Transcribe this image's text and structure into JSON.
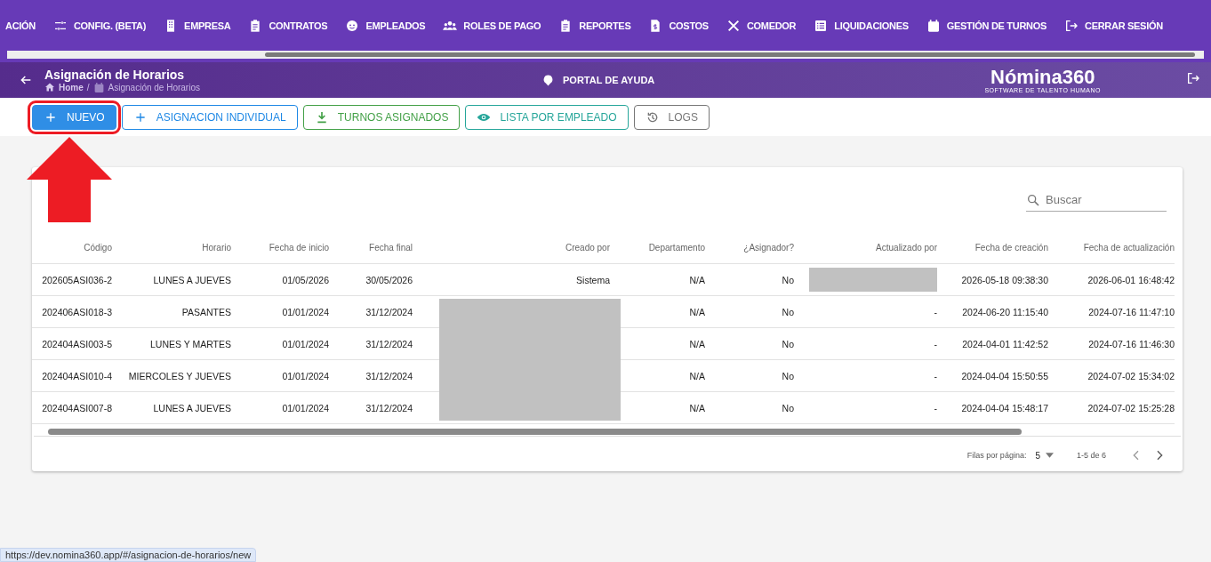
{
  "top_nav": [
    {
      "label": "ACIÓN"
    },
    {
      "label": "CONFIG. (BETA)"
    },
    {
      "label": "EMPRESA"
    },
    {
      "label": "CONTRATOS"
    },
    {
      "label": "EMPLEADOS"
    },
    {
      "label": "ROLES DE PAGO"
    },
    {
      "label": "REPORTES"
    },
    {
      "label": "COSTOS"
    },
    {
      "label": "COMEDOR"
    },
    {
      "label": "LIQUIDACIONES"
    },
    {
      "label": "GESTIÓN DE TURNOS"
    },
    {
      "label": "CERRAR SESIÓN"
    }
  ],
  "header": {
    "title": "Asignación de Horarios",
    "breadcrumb": [
      "Home",
      "Asignación de Horarios"
    ],
    "breadcrumb_separator": "/",
    "help": "PORTAL DE AYUDA",
    "logo": "Nómina360",
    "logo_tagline": "SOFTWARE DE TALENTO HUMANO"
  },
  "toolbar": [
    {
      "label": "NUEVO",
      "kind": "primary",
      "highlighted": true
    },
    {
      "label": "ASIGNACION INDIVIDUAL",
      "kind": "blue",
      "highlighted": false
    },
    {
      "label": "TURNOS ASIGNADOS",
      "kind": "green",
      "highlighted": false
    },
    {
      "label": "LISTA POR EMPLEADO",
      "kind": "teal",
      "highlighted": false
    },
    {
      "label": "LOGS",
      "kind": "grey",
      "highlighted": false
    }
  ],
  "search": {
    "placeholder": "Buscar"
  },
  "table": {
    "columns": [
      "Código",
      "Horario",
      "Fecha de inicio",
      "Fecha final",
      "Creado por",
      "Departamento",
      "¿Asignador?",
      "Actualizado por",
      "Fecha de creación",
      "Fecha de actualización"
    ],
    "rows": [
      {
        "codigo": "202605ASI036-2",
        "horario": "LUNES A JUEVES",
        "inicio": "01/05/2026",
        "final": "30/05/2026",
        "creado_por": "Sistema",
        "creado_por_redacted": false,
        "departamento": "N/A",
        "asignador": "No",
        "actualizado_por_redacted": true,
        "creacion": "2026-05-18 09:38:30",
        "actualizacion": "2026-06-01 16:48:42"
      },
      {
        "codigo": "202406ASI018-3",
        "horario": "PASANTES",
        "inicio": "01/01/2024",
        "final": "31/12/2024",
        "creado_por_redacted": true,
        "departamento": "N/A",
        "asignador": "No",
        "actualizado_por": "-",
        "actualizado_por_redacted": false,
        "creacion": "2024-06-20 11:15:40",
        "actualizacion": "2024-07-16 11:47:10"
      },
      {
        "codigo": "202404ASI003-5",
        "horario": "LUNES Y MARTES",
        "inicio": "01/01/2024",
        "final": "31/12/2024",
        "creado_por_redacted": true,
        "departamento": "N/A",
        "asignador": "No",
        "actualizado_por": "-",
        "actualizado_por_redacted": false,
        "creacion": "2024-04-01 11:42:52",
        "actualizacion": "2024-07-16 11:46:30"
      },
      {
        "codigo": "202404ASI010-4",
        "horario": "MIERCOLES Y JUEVES",
        "inicio": "01/01/2024",
        "final": "31/12/2024",
        "creado_por_redacted": true,
        "departamento": "N/A",
        "asignador": "No",
        "actualizado_por": "-",
        "actualizado_por_redacted": false,
        "creacion": "2024-04-04 15:50:55",
        "actualizacion": "2024-07-02 15:34:02"
      },
      {
        "codigo": "202404ASI007-8",
        "horario": "LUNES A JUEVES",
        "inicio": "01/01/2024",
        "final": "31/12/2024",
        "creado_por_redacted": true,
        "departamento": "N/A",
        "asignador": "No",
        "actualizado_por": "-",
        "actualizado_por_redacted": false,
        "creacion": "2024-04-04 15:48:17",
        "actualizacion": "2024-07-02 15:25:28"
      }
    ]
  },
  "pagination": {
    "rows_label": "Filas por página:",
    "rows_value": "5",
    "range": "1-5 de 6"
  },
  "status_bar": {
    "url": "https://dev.nomina360.app/#/asignacion-de-horarios/new"
  }
}
